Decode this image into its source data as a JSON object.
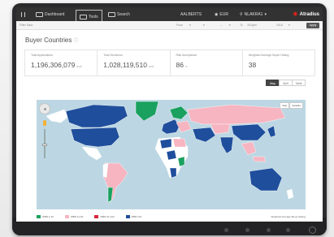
{
  "topbar": {
    "tabs": [
      {
        "label": "Dashboard"
      },
      {
        "label": "Tools"
      },
      {
        "label": "Search"
      }
    ],
    "company": "AALBERTS",
    "currency": "EUR",
    "user": "NLAKRA1",
    "brand": "Atradius"
  },
  "filters": {
    "left": "Filter Data",
    "from": "From",
    "to": "To",
    "to_date": "28 April",
    "year": "2016",
    "apply": "Apply"
  },
  "page": {
    "title": "Buyer Countries",
    "info_icon": "info-icon"
  },
  "stats": [
    {
      "label": "Total Applications",
      "value": "1,196,306,079",
      "unit": "EUR"
    },
    {
      "label": "Total Decisions",
      "value": "1,028,119,510",
      "unit": "EUR"
    },
    {
      "label": "Risk Acceptance",
      "value": "86",
      "unit": "%"
    },
    {
      "label": "Weighted Average Buyer Rating",
      "value": "38",
      "unit": ""
    }
  ],
  "views": [
    {
      "label": "Map"
    },
    {
      "label": "Split"
    },
    {
      "label": "Table"
    }
  ],
  "map": {
    "maptype": [
      "Map",
      "Satellite"
    ]
  },
  "legend": {
    "items": [
      {
        "label": "WBR 1-40",
        "color": "#1aa15f"
      },
      {
        "label": "WBR 41-60",
        "color": "#f6b5c1"
      },
      {
        "label": "WBR 61-100",
        "color": "#d7263d"
      },
      {
        "label": "WBR N/A",
        "color": "#1f4e9c"
      }
    ],
    "right": "Weighted Average Buyer Rating"
  },
  "colors": {
    "ocean": "#bcd7e3",
    "land_default": "#ffffff",
    "green": "#1aa15f",
    "pink": "#f6b5c1",
    "blue": "#1f4e9c",
    "red": "#d7263d"
  }
}
